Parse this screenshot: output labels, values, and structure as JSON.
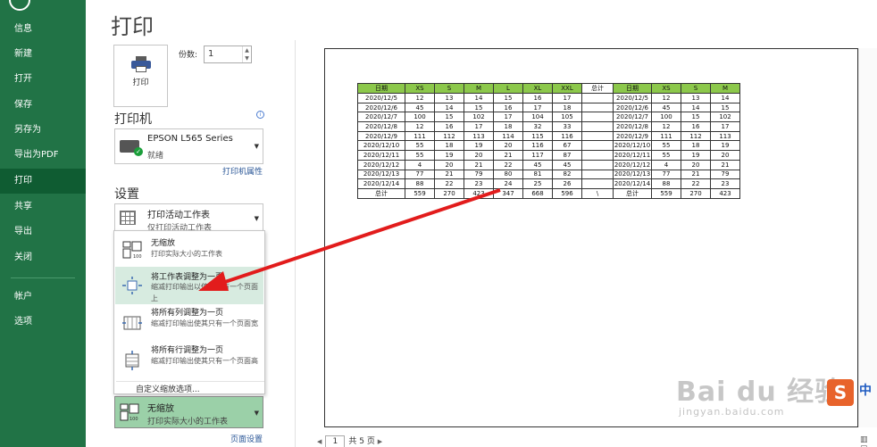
{
  "nav": {
    "items": [
      "信息",
      "新建",
      "打开",
      "保存",
      "另存为",
      "导出为PDF",
      "打印",
      "共享",
      "导出",
      "关闭",
      "帐户",
      "选项"
    ],
    "active": "打印"
  },
  "page_title": "打印",
  "print_button_label": "打印",
  "copies": {
    "label": "份数:",
    "value": "1"
  },
  "printer_section": {
    "title": "打印机",
    "name": "EPSON L565 Series",
    "status": "就绪",
    "properties_link": "打印机属性"
  },
  "settings_section": {
    "title": "设置",
    "print_what": {
      "main": "打印活动工作表",
      "sub": "仅打印活动工作表"
    }
  },
  "scaling_menu": {
    "items": [
      {
        "title": "无缩放",
        "desc": "打印实际大小的工作表"
      },
      {
        "title": "将工作表调整为一页",
        "desc": "缩减打印输出以使其只有一个页面上"
      },
      {
        "title": "将所有列调整为一页",
        "desc": "缩减打印输出使其只有一个页面宽"
      },
      {
        "title": "将所有行调整为一页",
        "desc": "缩减打印输出使其只有一个页面高"
      }
    ],
    "custom": "自定义缩放选项...",
    "highlighted_index": 1
  },
  "scaling_select": {
    "main": "无缩放",
    "sub": "打印实际大小的工作表"
  },
  "page_setup_link": "页面设置",
  "pager": {
    "current": "1",
    "total_text": "共 5 页"
  },
  "preview_table": {
    "headers": [
      "日期",
      "XS",
      "S",
      "M",
      "L",
      "XL",
      "XXL",
      "总计",
      "日期",
      "XS",
      "S",
      "M"
    ],
    "rows": [
      [
        "2020/12/5",
        "12",
        "13",
        "14",
        "15",
        "16",
        "17",
        "",
        "2020/12/5",
        "12",
        "13",
        "14"
      ],
      [
        "2020/12/6",
        "45",
        "14",
        "15",
        "16",
        "17",
        "18",
        "",
        "2020/12/6",
        "45",
        "14",
        "15"
      ],
      [
        "2020/12/7",
        "100",
        "15",
        "102",
        "17",
        "104",
        "105",
        "",
        "2020/12/7",
        "100",
        "15",
        "102"
      ],
      [
        "2020/12/8",
        "12",
        "16",
        "17",
        "18",
        "32",
        "33",
        "",
        "2020/12/8",
        "12",
        "16",
        "17"
      ],
      [
        "2020/12/9",
        "111",
        "112",
        "113",
        "114",
        "115",
        "116",
        "",
        "2020/12/9",
        "111",
        "112",
        "113"
      ],
      [
        "2020/12/10",
        "55",
        "18",
        "19",
        "20",
        "116",
        "67",
        "",
        "2020/12/10",
        "55",
        "18",
        "19"
      ],
      [
        "2020/12/11",
        "55",
        "19",
        "20",
        "21",
        "117",
        "87",
        "",
        "2020/12/11",
        "55",
        "19",
        "20"
      ],
      [
        "2020/12/12",
        "4",
        "20",
        "21",
        "22",
        "45",
        "45",
        "",
        "2020/12/12",
        "4",
        "20",
        "21"
      ],
      [
        "2020/12/13",
        "77",
        "21",
        "79",
        "80",
        "81",
        "82",
        "",
        "2020/12/13",
        "77",
        "21",
        "79"
      ],
      [
        "2020/12/14",
        "88",
        "22",
        "23",
        "24",
        "25",
        "26",
        "",
        "2020/12/14",
        "88",
        "22",
        "23"
      ],
      [
        "总计",
        "559",
        "270",
        "423",
        "347",
        "668",
        "596",
        "\\",
        "总计",
        "559",
        "270",
        "423"
      ]
    ]
  },
  "watermark": {
    "main": "Bai du 经验",
    "sub": "jingyan.baidu.com"
  },
  "ime": {
    "logo": "S",
    "lang": "中"
  },
  "colors": {
    "nav_green": "#217346",
    "header_green": "#8cc84b",
    "arrow_red": "#e21c1c"
  }
}
